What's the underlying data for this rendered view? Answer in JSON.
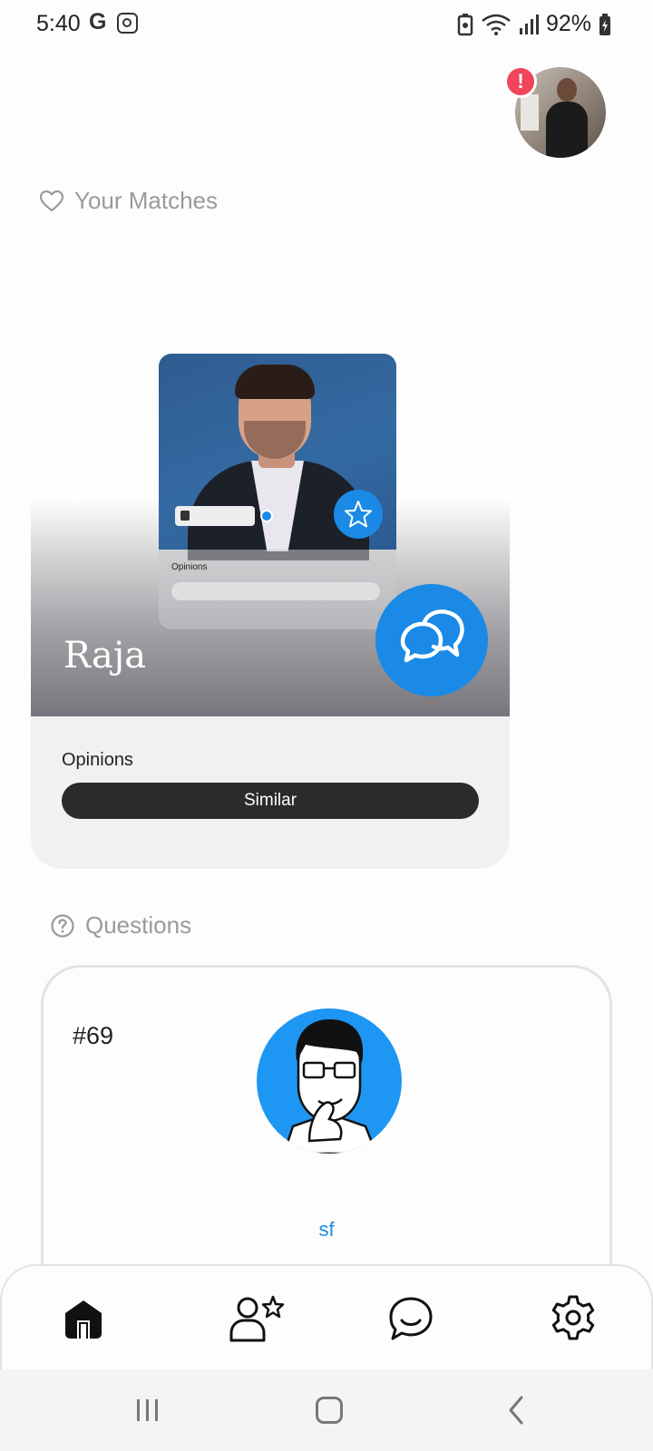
{
  "status_bar": {
    "time": "5:40",
    "g_icon_text": "G",
    "battery_percent": "92%"
  },
  "profile": {
    "alert_badge": "!"
  },
  "matches_section": {
    "heading": "Your Matches"
  },
  "match_card": {
    "name": "Raja",
    "photo_opinions_label": "Opinions",
    "opinions_label": "Opinions",
    "opinion_value": "Similar"
  },
  "questions_section": {
    "heading": "Questions",
    "question_number": "#69",
    "author": "sf"
  },
  "colors": {
    "accent": "#1a8ae6",
    "alert": "#f0455a",
    "pill": "#2b2b2d"
  },
  "icons": {
    "heart": "heart-icon",
    "question": "question-circle-icon",
    "star": "star-icon",
    "chat": "chat-bubbles-icon",
    "home": "home-icon",
    "profile": "profile-star-icon",
    "messages": "message-icon",
    "settings": "gear-icon"
  }
}
